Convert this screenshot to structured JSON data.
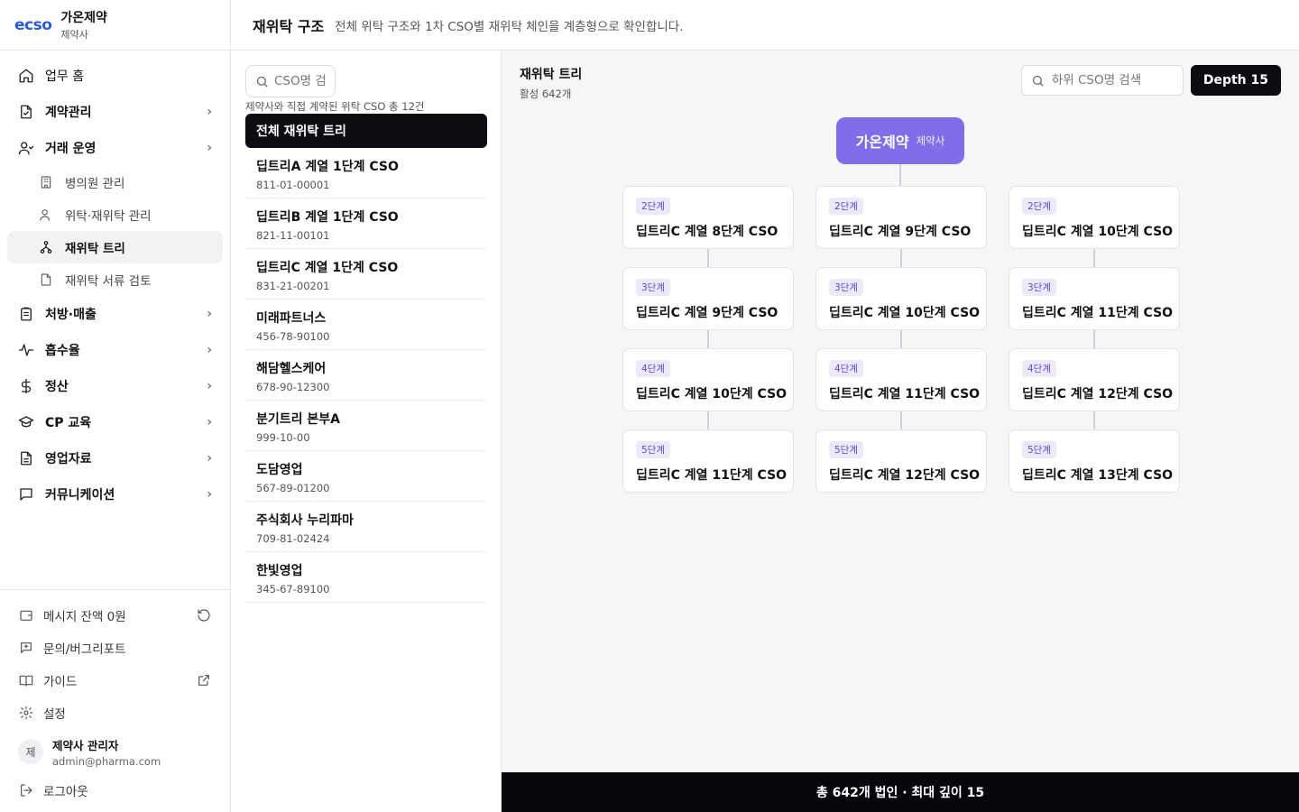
{
  "brand": {
    "logo": "ecso",
    "name": "가온제약",
    "sub": "제약사"
  },
  "nav": {
    "items": [
      {
        "label": "업무 홈",
        "icon": "home-icon",
        "chevron": false,
        "bold": false
      },
      {
        "label": "계약관리",
        "icon": "contract-icon",
        "chevron": true,
        "bold": true
      },
      {
        "label": "거래 운영",
        "icon": "user-icon",
        "chevron": true,
        "bold": true
      }
    ],
    "sub_items": [
      {
        "label": "병의원 관리",
        "icon": "building-icon",
        "active": false
      },
      {
        "label": "위탁·재위탁 관리",
        "icon": "users-icon",
        "active": false
      },
      {
        "label": "재위탁 트리",
        "icon": "tree-icon",
        "active": true
      },
      {
        "label": "재위탁 서류 검토",
        "icon": "file-icon",
        "active": false
      }
    ],
    "items2": [
      {
        "label": "처방·매출",
        "icon": "clipboard-icon"
      },
      {
        "label": "흡수율",
        "icon": "pulse-icon"
      },
      {
        "label": "정산",
        "icon": "dollar-icon"
      },
      {
        "label": "CP 교육",
        "icon": "graduation-icon"
      },
      {
        "label": "영업자료",
        "icon": "document-icon"
      },
      {
        "label": "커뮤니케이션",
        "icon": "chat-icon"
      }
    ]
  },
  "bottom": {
    "balance": "메시지 잔액 0원",
    "inquiry": "문의/버그리포트",
    "guide": "가이드",
    "settings": "설정",
    "logout": "로그아웃"
  },
  "user": {
    "avatar": "제",
    "name": "제약사 관리자",
    "email": "admin@pharma.com"
  },
  "header": {
    "title": "재위탁 구조",
    "description": "전체 위탁 구조와 1차 CSO별 재위탁 체인을 계층형으로 확인합니다."
  },
  "list": {
    "search_placeholder": "CSO명 검색",
    "caption": "제약사와 직접 계약된 위탁 CSO 총 12건",
    "all_label": "전체 재위탁 트리",
    "rows": [
      {
        "name": "딥트리A 계열 1단계 CSO",
        "id": "811-01-00001"
      },
      {
        "name": "딥트리B 계열 1단계 CSO",
        "id": "821-11-00101"
      },
      {
        "name": "딥트리C 계열 1단계 CSO",
        "id": "831-21-00201"
      },
      {
        "name": "미래파트너스",
        "id": "456-78-90100"
      },
      {
        "name": "해담헬스케어",
        "id": "678-90-12300"
      },
      {
        "name": "분기트리 본부A",
        "id": "999-10-00"
      },
      {
        "name": "도담영업",
        "id": "567-89-01200"
      },
      {
        "name": "주식회사 누리파마",
        "id": "709-81-02424"
      },
      {
        "name": "한빛영업",
        "id": "345-67-89100"
      }
    ]
  },
  "tree": {
    "title": "재위탁 트리",
    "count": "활성 642개",
    "search_placeholder": "하위 CSO명 검색",
    "depth_button": "Depth 15",
    "root": {
      "name": "가온제약",
      "sub": "제약사"
    },
    "columns": [
      [
        {
          "badge": "2단계",
          "name": "딥트리C 계열 8단계 CSO"
        },
        {
          "badge": "3단계",
          "name": "딥트리C 계열 9단계 CSO"
        },
        {
          "badge": "4단계",
          "name": "딥트리C 계열 10단계 CSO"
        },
        {
          "badge": "5단계",
          "name": "딥트리C 계열 11단계 CSO"
        }
      ],
      [
        {
          "badge": "2단계",
          "name": "딥트리C 계열 9단계 CSO"
        },
        {
          "badge": "3단계",
          "name": "딥트리C 계열 10단계 CSO"
        },
        {
          "badge": "4단계",
          "name": "딥트리C 계열 11단계 CSO"
        },
        {
          "badge": "5단계",
          "name": "딥트리C 계열 12단계 CSO"
        }
      ],
      [
        {
          "badge": "2단계",
          "name": "딥트리C 계열 10단계 CSO"
        },
        {
          "badge": "3단계",
          "name": "딥트리C 계열 11단계 CSO"
        },
        {
          "badge": "4단계",
          "name": "딥트리C 계열 12단계 CSO"
        },
        {
          "badge": "5단계",
          "name": "딥트리C 계열 13단계 CSO"
        }
      ]
    ]
  },
  "status_bar": "총 642개 법인 · 최대 깊이 15",
  "colors": {
    "accent": "#7f6ee8",
    "dark": "#0b0d12",
    "badge_bg": "#ece9fb",
    "badge_text": "#5b4bd0"
  }
}
